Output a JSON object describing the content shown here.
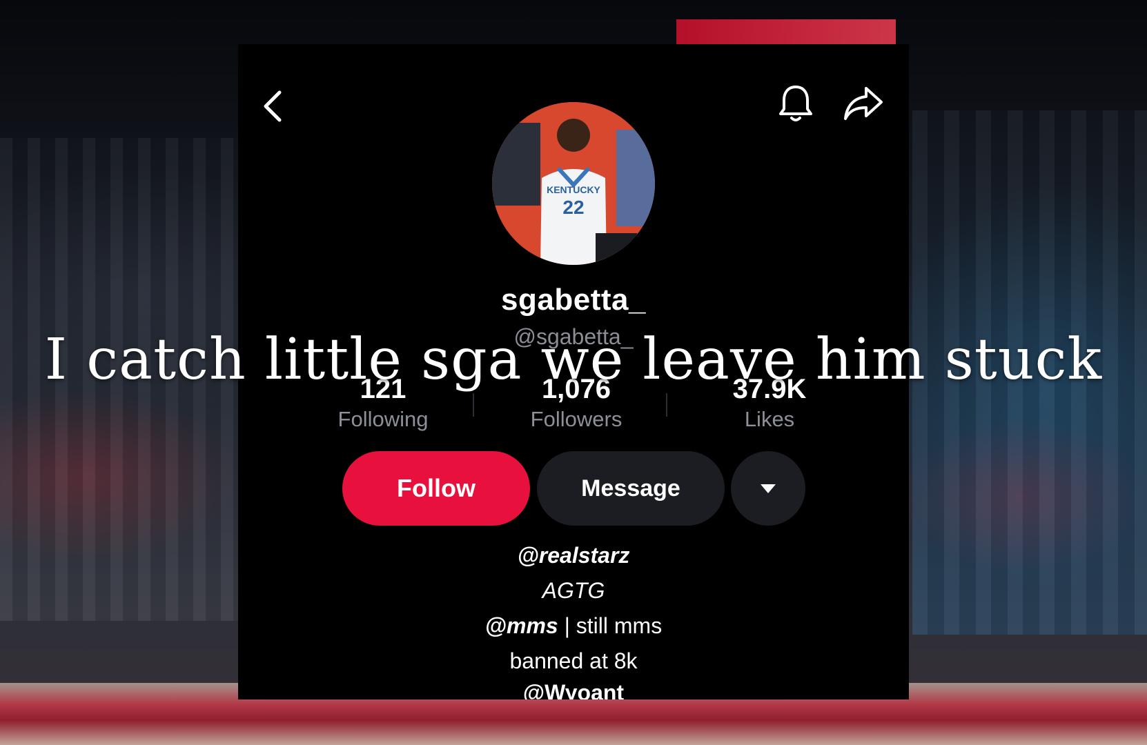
{
  "profile": {
    "display_name": "sgabetta_",
    "username": "@sgabetta_"
  },
  "stats": [
    {
      "value": "121",
      "label": "Following"
    },
    {
      "value": "1,076",
      "label": "Followers"
    },
    {
      "value": "37.9K",
      "label": "Likes"
    }
  ],
  "actions": {
    "follow_label": "Follow",
    "message_label": "Message",
    "more_icon": "caret-down-icon"
  },
  "header": {
    "back_icon": "chevron-left-icon",
    "notification_icon": "bell-icon",
    "share_icon": "share-arrow-icon"
  },
  "bio": {
    "line1": "@realstarz",
    "line2": "AGTG",
    "line3_mention": "@mms",
    "line3_rest": " | still mms",
    "line4": "banned at 8k",
    "line5": "@Wyoant"
  },
  "overlay": {
    "caption": "I catch little sga we leave him stuck"
  },
  "colors": {
    "follow_button": "#e8103c",
    "panel_background": "#000000",
    "secondary_text": "#8a8e96",
    "button_dark": "#1b1d22"
  }
}
